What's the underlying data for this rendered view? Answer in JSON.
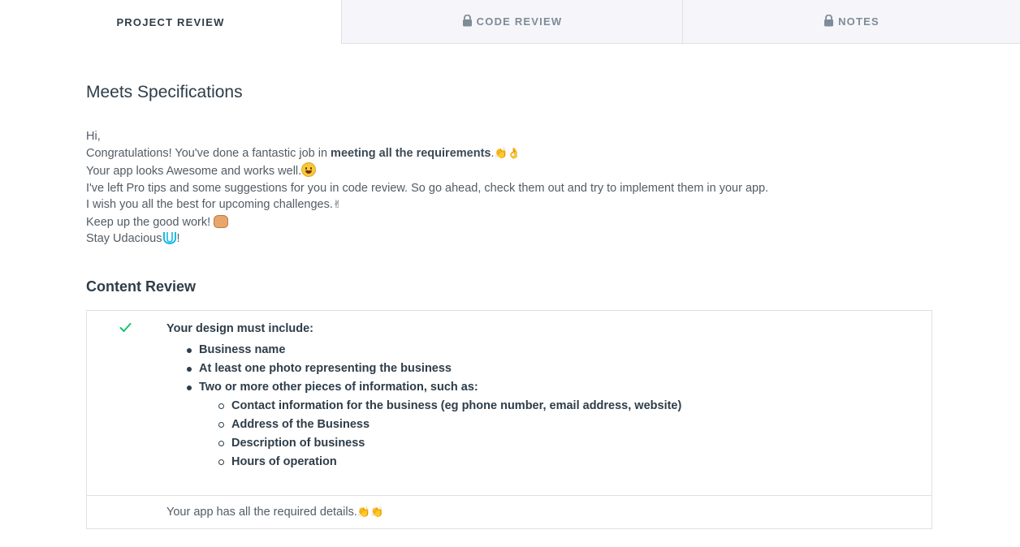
{
  "tabs": [
    {
      "label": "PROJECT REVIEW",
      "locked": false,
      "active": true
    },
    {
      "label": "CODE REVIEW",
      "locked": true,
      "active": false
    },
    {
      "label": "NOTES",
      "locked": true,
      "active": false
    }
  ],
  "review": {
    "status_title": "Meets Specifications",
    "intro": {
      "line1": "Hi,",
      "line2_a": "Congratulations! You've done a fantastic job in ",
      "line2_b": "meeting all the requirements",
      "line2_c": ".",
      "line2_emoji": "👏👌",
      "line3": "Your app looks Awesome and works well.",
      "line3_emoji": "😄",
      "line4": "I've left Pro tips and some suggestions for you in code review. So go ahead, check them out and try to implement them in your app.",
      "line5": "I wish you all the best for upcoming challenges.",
      "line5_emoji": "✌",
      "line6": "Keep up the good work! ",
      "line6_emoji": "👊",
      "line7_a": "Stay Udacious",
      "line7_b": "!"
    }
  },
  "content_review": {
    "heading": "Content Review",
    "criteria_title": "Your design must include:",
    "items": [
      "Business name",
      "At least one photo representing the business",
      "Two or more other pieces of information, such as:"
    ],
    "subitems": [
      "Contact information for the business (eg phone number, email address, website)",
      "Address of the Business",
      "Description of business",
      "Hours of operation"
    ],
    "comment": "Your app has all the required details.",
    "comment_emoji": "👏👏"
  },
  "colors": {
    "text": "#2e3d49",
    "muted": "#525c65",
    "tab_inactive_bg": "#f5f5fa",
    "border": "#dbe2e8",
    "check": "#15c26b",
    "udacity": "#02b3e4"
  },
  "icons": {
    "lock": "lock-icon",
    "check": "check-icon",
    "udacity": "udacity-logo-icon"
  }
}
